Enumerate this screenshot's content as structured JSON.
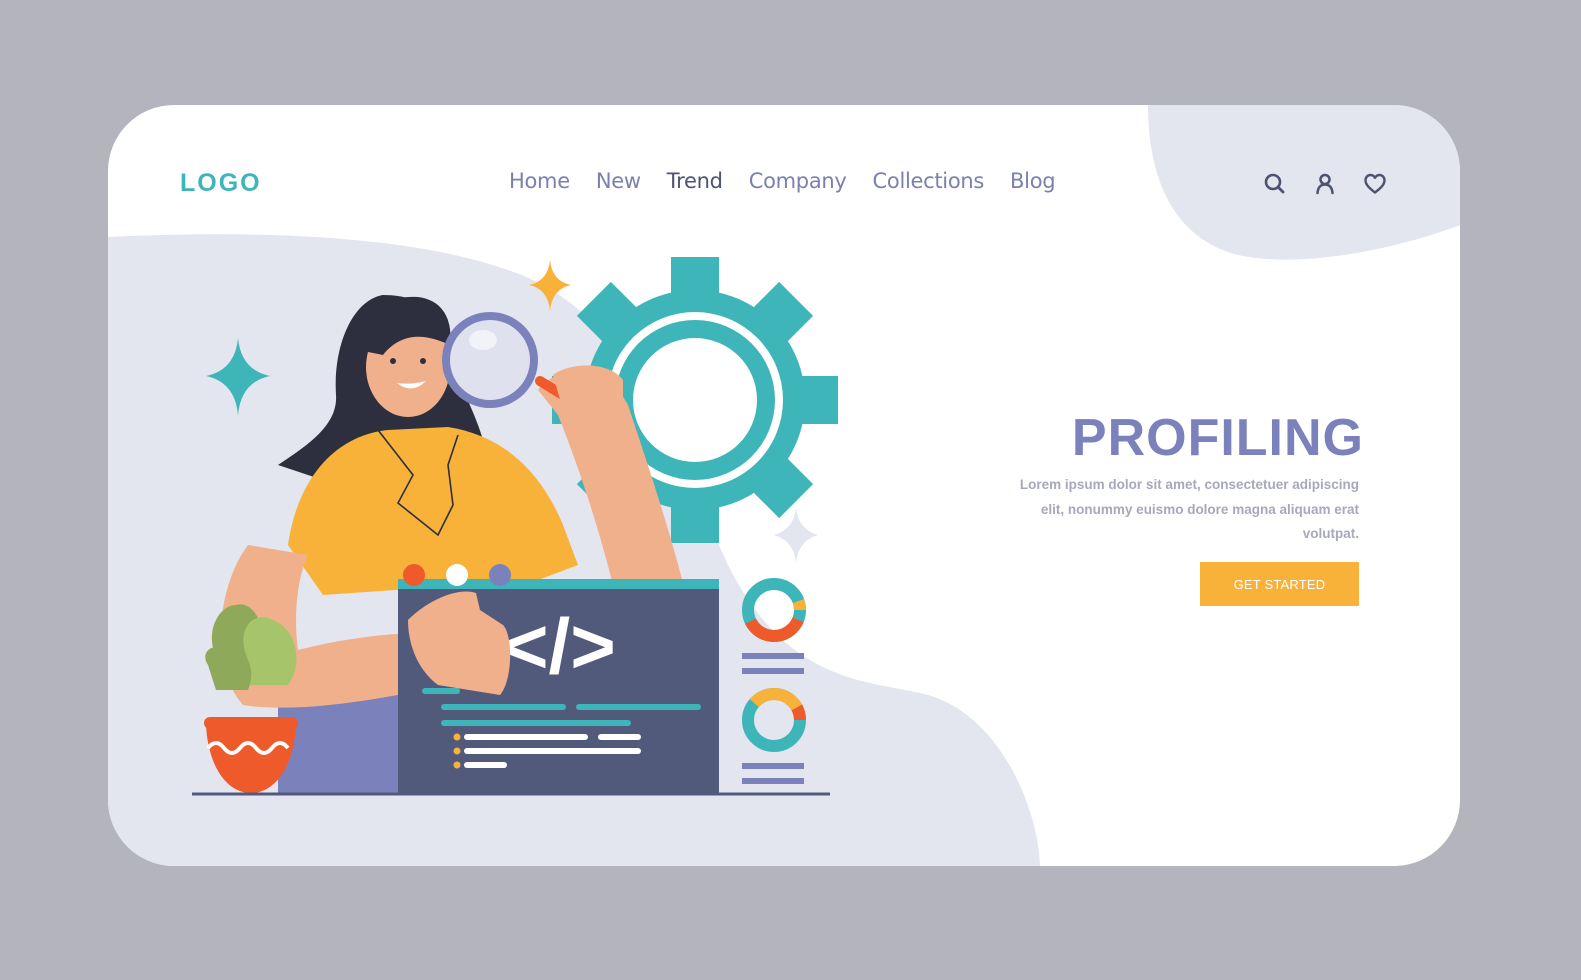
{
  "header": {
    "logo": "LOGO",
    "nav": [
      {
        "label": "Home",
        "active": false
      },
      {
        "label": "New",
        "active": false
      },
      {
        "label": "Trend",
        "active": true
      },
      {
        "label": "Company",
        "active": false
      },
      {
        "label": "Collections",
        "active": false
      },
      {
        "label": "Blog",
        "active": false
      }
    ],
    "icons": [
      "search-icon",
      "user-icon",
      "heart-icon"
    ]
  },
  "hero": {
    "title": "PROFILING",
    "description": "Lorem ipsum dolor sit amet, consectetuer adipiscing elit, nonummy euismo dolore magna aliquam erat volutpat.",
    "cta_label": "GET STARTED"
  },
  "illustration": {
    "code_symbol": "</>"
  },
  "colors": {
    "accent_teal": "#3eb5b8",
    "nav_text": "#7a81ae",
    "title": "#7b81bb",
    "cta": "#f8b23a",
    "frame_bg": "#b3b4be",
    "blob": "#e3e5ef",
    "code_window": "#525a7b",
    "shirt": "#f8b23a",
    "accent_orange": "#ee5a2a"
  }
}
